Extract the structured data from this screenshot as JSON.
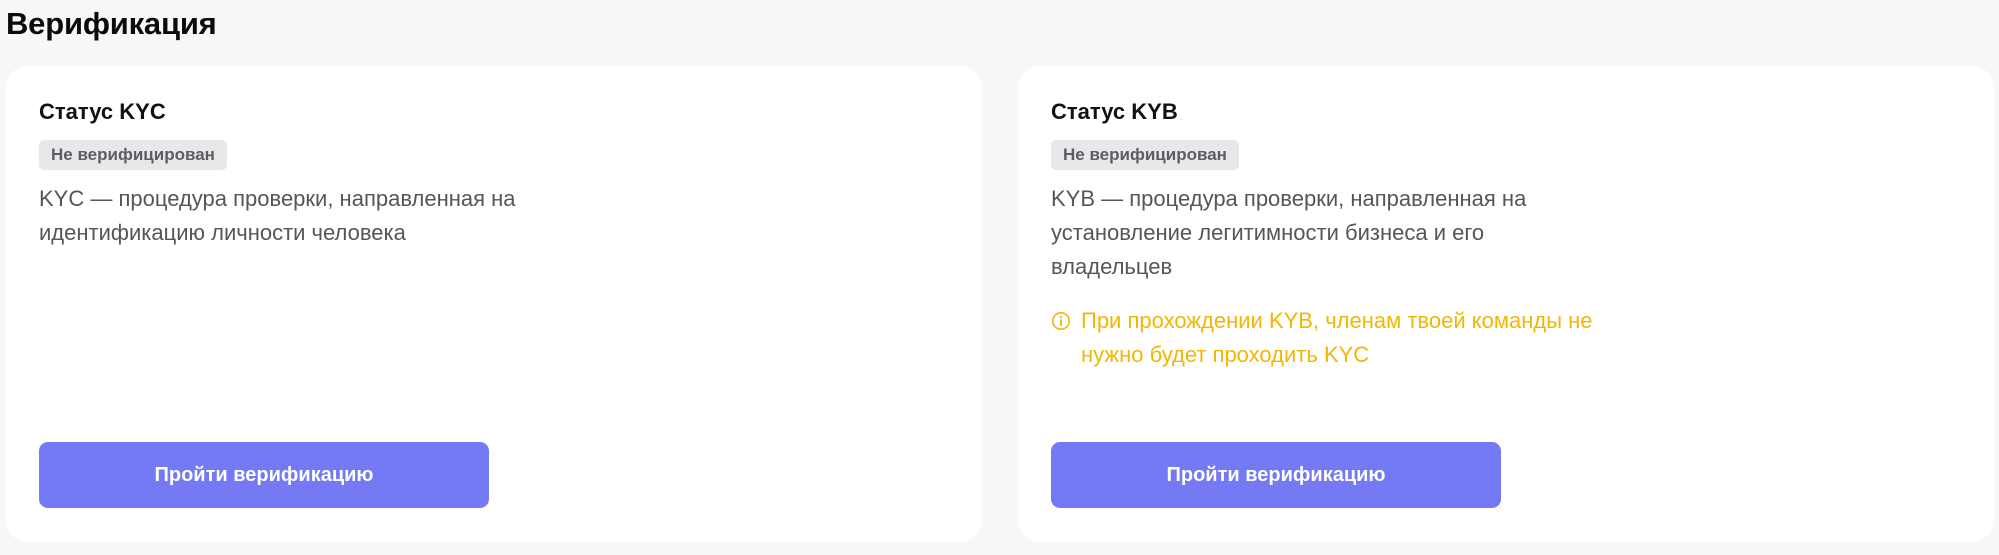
{
  "page": {
    "title": "Верификация"
  },
  "cards": {
    "kyc": {
      "title": "Статус KYC",
      "status": "Не верифицирован",
      "description": "KYC — процедура проверки, направленная на идентификацию личности человека",
      "button_label": "Пройти верификацию"
    },
    "kyb": {
      "title": "Статус KYB",
      "status": "Не верифицирован",
      "description": "KYB — процедура проверки, направленная на установление легитимности бизнеса и его владельцев",
      "warning": "При прохождении KYB, членам твоей команды не нужно будет проходить KYC",
      "warning_icon": "info-circle-icon",
      "button_label": "Пройти верификацию"
    }
  },
  "colors": {
    "background": "#f6f7f9",
    "card": "#ffffff",
    "badge_bg": "#e8e8ea",
    "badge_text": "#5d5d62",
    "warning": "#f2b705",
    "button": "#7479f4"
  }
}
